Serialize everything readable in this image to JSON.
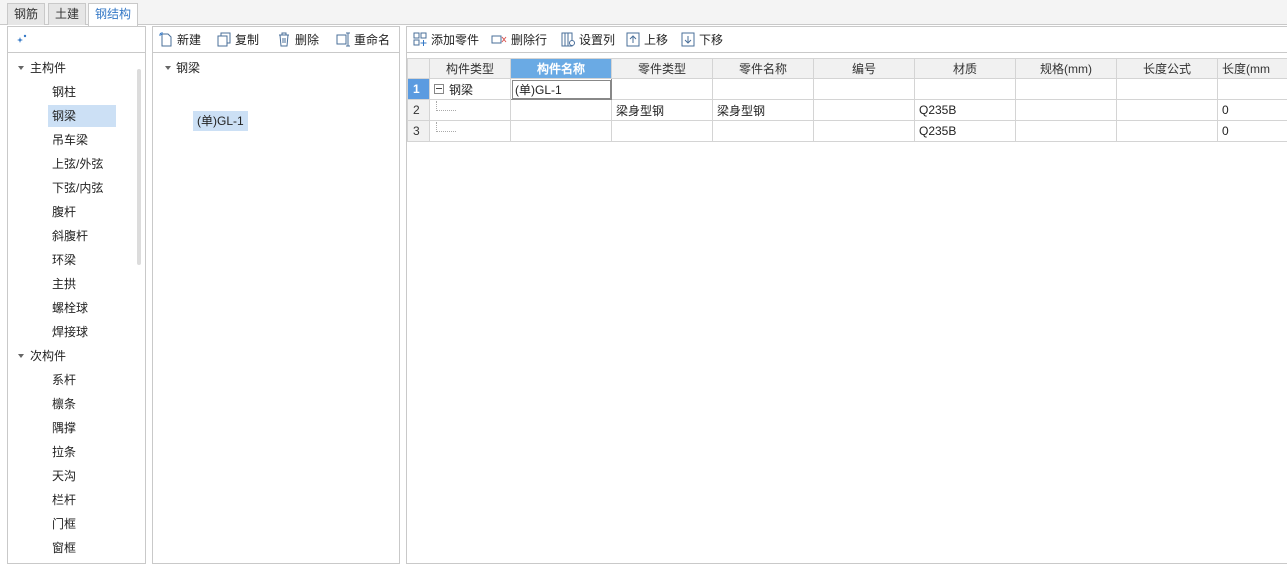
{
  "tabs": [
    {
      "label": "钢筋",
      "active": false
    },
    {
      "label": "土建",
      "active": false
    },
    {
      "label": "钢结构",
      "active": true
    }
  ],
  "left_panel": {
    "groups": [
      {
        "label": "主构件",
        "items": [
          "钢柱",
          "钢梁",
          "吊车梁",
          "上弦/外弦",
          "下弦/内弦",
          "腹杆",
          "斜腹杆",
          "环梁",
          "主拱",
          "螺栓球",
          "焊接球"
        ]
      },
      {
        "label": "次构件",
        "items": [
          "系杆",
          "檩条",
          "隅撑",
          "拉条",
          "天沟",
          "栏杆",
          "门框",
          "窗框"
        ]
      }
    ],
    "selected_item": "钢梁"
  },
  "middle_panel": {
    "toolbar": {
      "new": "新建",
      "copy": "复制",
      "delete": "删除",
      "rename": "重命名"
    },
    "tree": {
      "group": "钢梁",
      "item": "(单)GL-1"
    }
  },
  "right_panel": {
    "toolbar": {
      "add_part": "添加零件",
      "delete_row": "删除行",
      "set_columns": "设置列",
      "move_up": "上移",
      "move_down": "下移"
    },
    "columns": [
      "构件类型",
      "构件名称",
      "零件类型",
      "零件名称",
      "编号",
      "材质",
      "规格(mm)",
      "长度公式",
      "长度(mm"
    ],
    "rows": [
      {
        "num": "1",
        "type": "钢梁",
        "name": "(单)GL-1",
        "part_type": "",
        "part_name": "",
        "code": "",
        "material": "",
        "spec": "",
        "length_formula": "",
        "length": ""
      },
      {
        "num": "2",
        "type": "",
        "name": "",
        "part_type": "梁身型钢",
        "part_name": "梁身型钢",
        "code": "",
        "material": "Q235B",
        "spec": "",
        "length_formula": "",
        "length": "0"
      },
      {
        "num": "3",
        "type": "",
        "name": "",
        "part_type": "",
        "part_name": "",
        "code": "",
        "material": "Q235B",
        "spec": "",
        "length_formula": "",
        "length": "0"
      }
    ]
  },
  "colors": {
    "accent": "#3478c6",
    "selection": "#cce0f5",
    "header_highlight": "#6aaae4"
  }
}
